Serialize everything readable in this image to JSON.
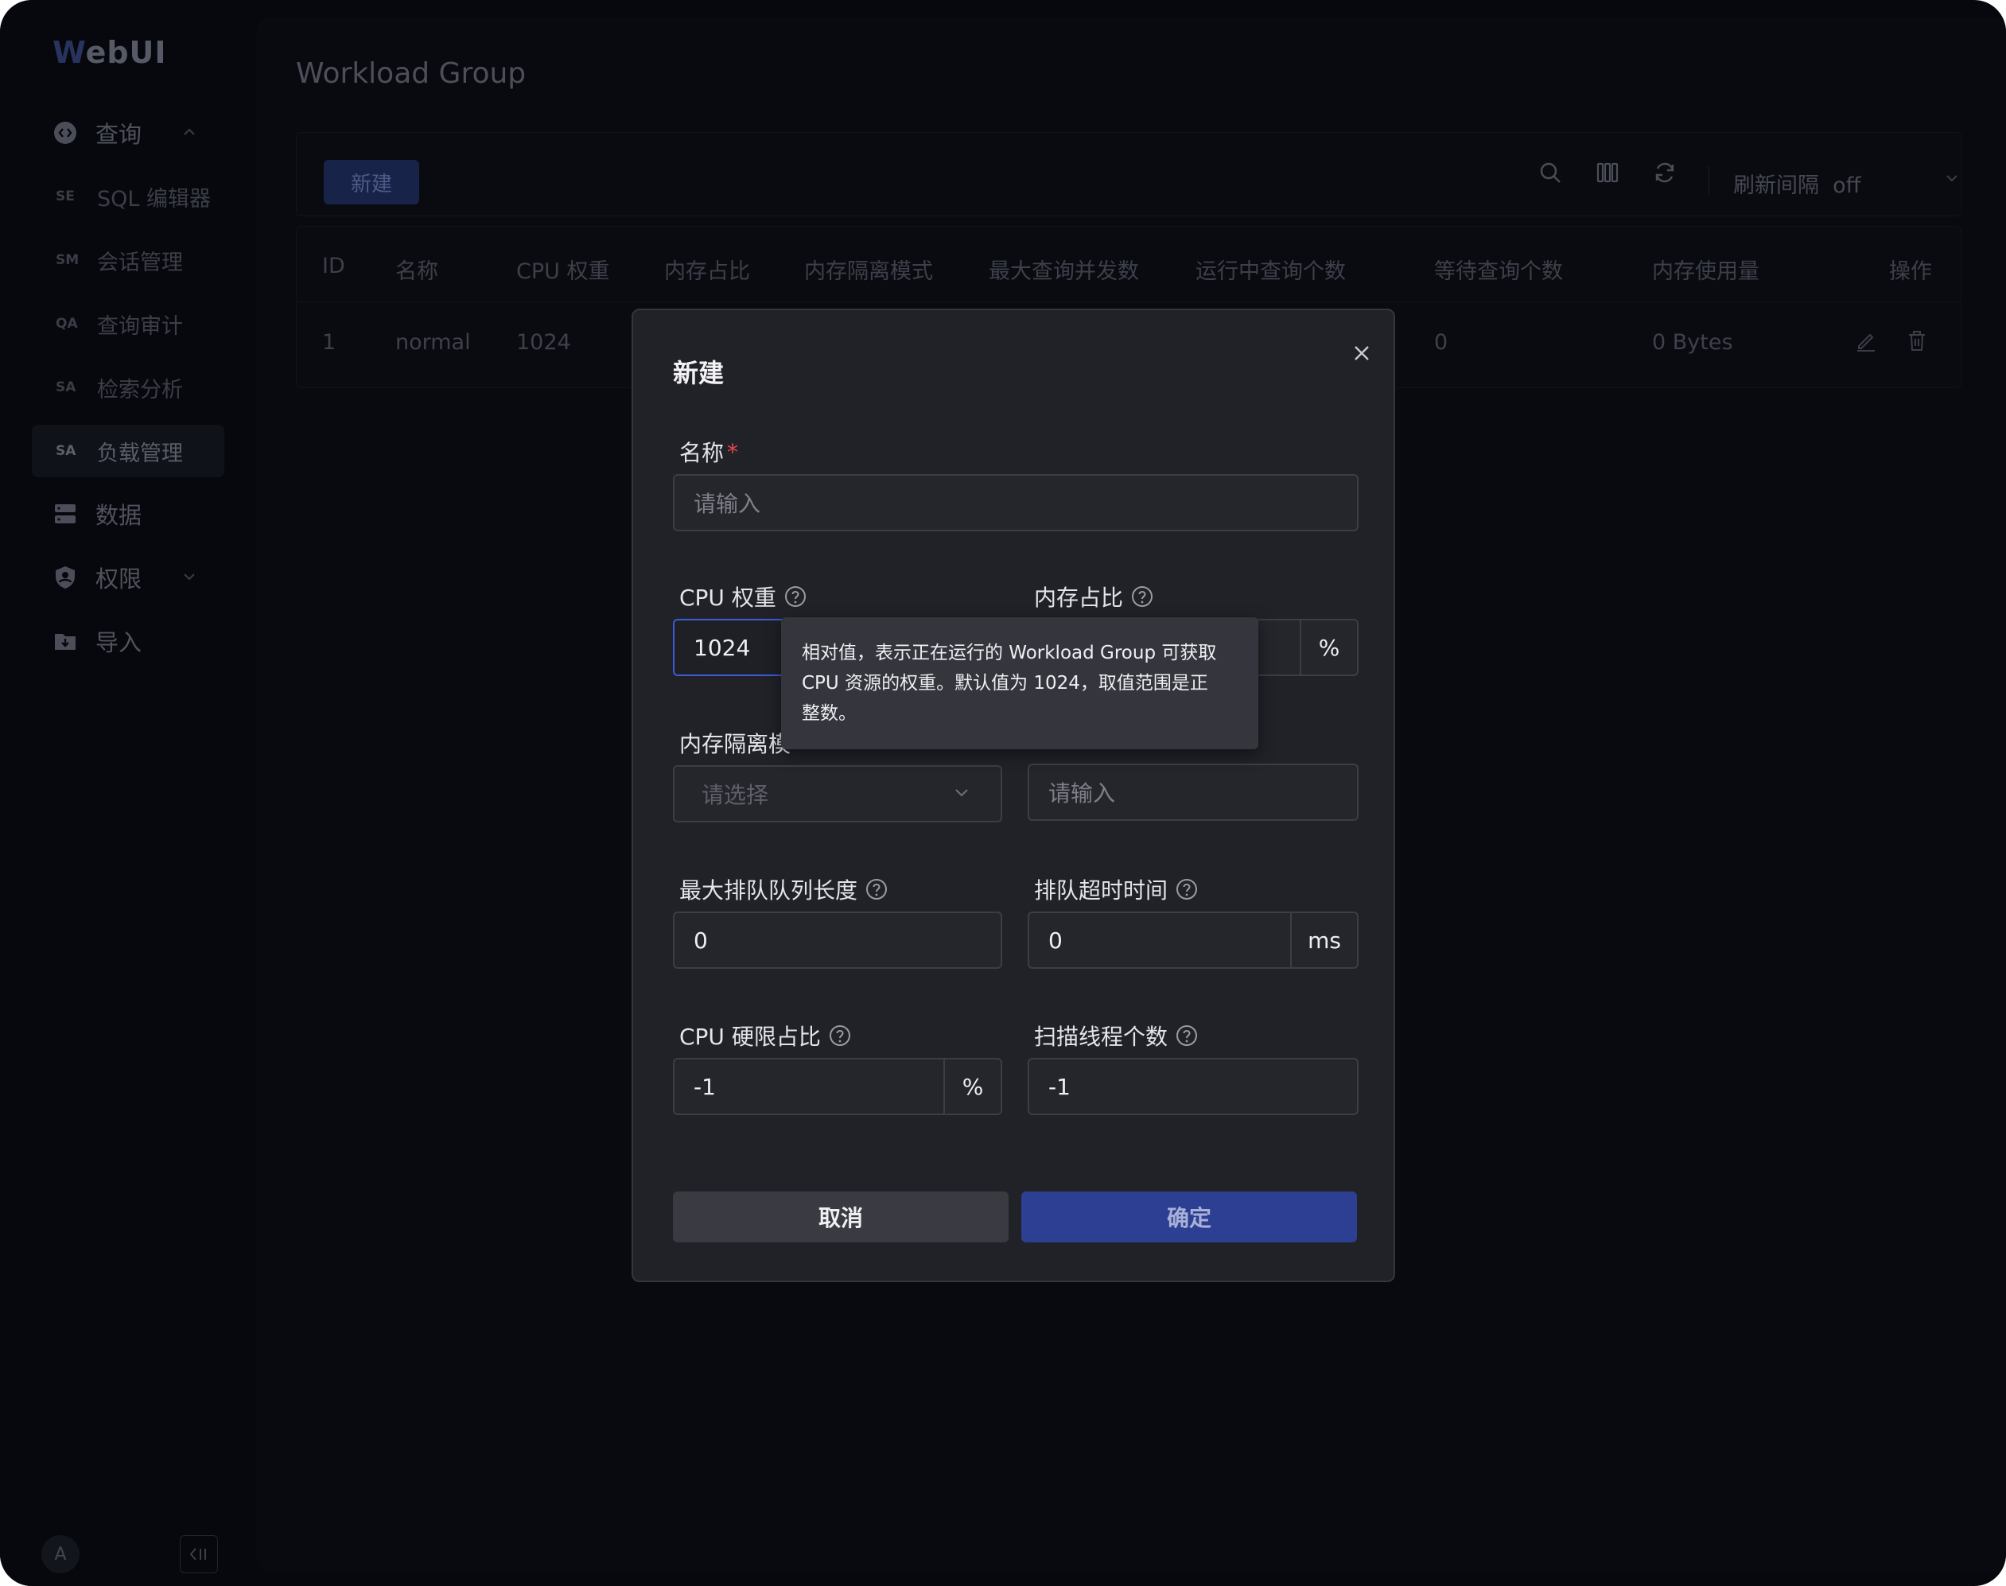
{
  "app": {
    "logo": "WebUI",
    "logo_first": "W",
    "logo_rest": "ebUI"
  },
  "sidebar": {
    "items": [
      {
        "abbr": "",
        "label": "查询",
        "icon": "code-bubble-icon"
      },
      {
        "abbr": "SE",
        "label": "SQL 编辑器"
      },
      {
        "abbr": "SM",
        "label": "会话管理"
      },
      {
        "abbr": "QA",
        "label": "查询审计"
      },
      {
        "abbr": "SA",
        "label": "检索分析"
      },
      {
        "abbr": "SA",
        "label": "负载管理"
      },
      {
        "abbr": "",
        "label": "数据",
        "icon": "database-icon"
      },
      {
        "abbr": "",
        "label": "权限",
        "icon": "shield-user-icon"
      },
      {
        "abbr": "",
        "label": "导入",
        "icon": "folder-import-icon"
      }
    ],
    "avatar": "A"
  },
  "page": {
    "title": "Workload Group"
  },
  "toolbar": {
    "new_label": "新建",
    "refresh_label": "刷新间隔",
    "refresh_value": "off"
  },
  "table": {
    "headers": [
      "ID",
      "名称",
      "CPU 权重",
      "内存占比",
      "内存隔离模式",
      "最大查询并发数",
      "运行中查询个数",
      "等待查询个数",
      "内存使用量",
      "操作"
    ],
    "rows": [
      {
        "id": "1",
        "name": "normal",
        "cpu": "1024",
        "waiting": "0",
        "memory": "0 Bytes"
      }
    ]
  },
  "modal": {
    "title": "新建",
    "name_label": "名称",
    "required_mark": "*",
    "name_placeholder": "请输入",
    "cpu_label": "CPU 权重",
    "cpu_value": "1024",
    "mem_label": "内存占比",
    "mem_unit": "%",
    "iso_label": "内存隔离模",
    "iso_placeholder": "请选择",
    "fourth_placeholder": "请输入",
    "queue_label": "最大排队队列长度",
    "queue_value": "0",
    "timeout_label": "排队超时时间",
    "timeout_value": "0",
    "timeout_unit": "ms",
    "cpu_hard_label": "CPU 硬限占比",
    "cpu_hard_value": "-1",
    "cpu_hard_unit": "%",
    "scan_label": "扫描线程个数",
    "scan_value": "-1",
    "cancel_label": "取消",
    "ok_label": "确定"
  },
  "tooltip": {
    "line1": "相对值，表示正在运行的 Workload Group 可获取",
    "line2": "CPU 资源的权重。默认值为 1024，取值范围是正",
    "line3": "整数。"
  },
  "colors": {
    "accent": "#2d3f93",
    "focus": "#3a5cd8",
    "required": "#e5484d"
  }
}
